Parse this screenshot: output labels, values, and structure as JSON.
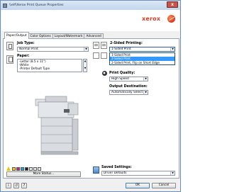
{
  "window": {
    "title": "\\\\elf\\Xerox Print Queue Properties",
    "close_glyph": "x"
  },
  "brand": {
    "name": "xerox"
  },
  "tabs": [
    {
      "label": "Paper/Output",
      "active": true
    },
    {
      "label": "Color Options",
      "active": false
    },
    {
      "label": "Layout/Watermark",
      "active": false
    },
    {
      "label": "Advanced",
      "active": false
    }
  ],
  "job_type": {
    "label": "Job Type:",
    "value": "Normal Print"
  },
  "paper": {
    "label": "Paper:",
    "lines": [
      "-Letter (8.5 x 11\")",
      "-White",
      "-Printer Default Type"
    ]
  },
  "two_sided": {
    "label": "2-Sided Printing:",
    "value": "1-Sided Print",
    "options": [
      "1-Sided Print",
      "2-Sided Print",
      "2-Sided Print, Flip on Short Edge"
    ],
    "highlighted_index": 1
  },
  "print_quality": {
    "label": "Print Quality:",
    "value": "High Speed"
  },
  "output_destination": {
    "label": "Output Destination:",
    "value": "Automatically Select"
  },
  "more_status": {
    "label": "More Status..."
  },
  "saved_settings": {
    "label": "Saved Settings:",
    "value": "Driver Defaults"
  },
  "buttons": {
    "ok": "OK",
    "cancel": "Cancel"
  },
  "icons": {
    "info_icon": "i",
    "help_icon": "?",
    "reset_icon": "↺",
    "dropdown_arrow": "▼",
    "scroll_up": "▲",
    "scroll_down": "▼"
  },
  "colors": {
    "accent": "#3399ff",
    "brand_red": "#e03c1f",
    "status_yellow": "#f5d000",
    "status_magenta": "#d0208a",
    "status_cyan": "#19a9e0",
    "status_black": "#222222"
  }
}
